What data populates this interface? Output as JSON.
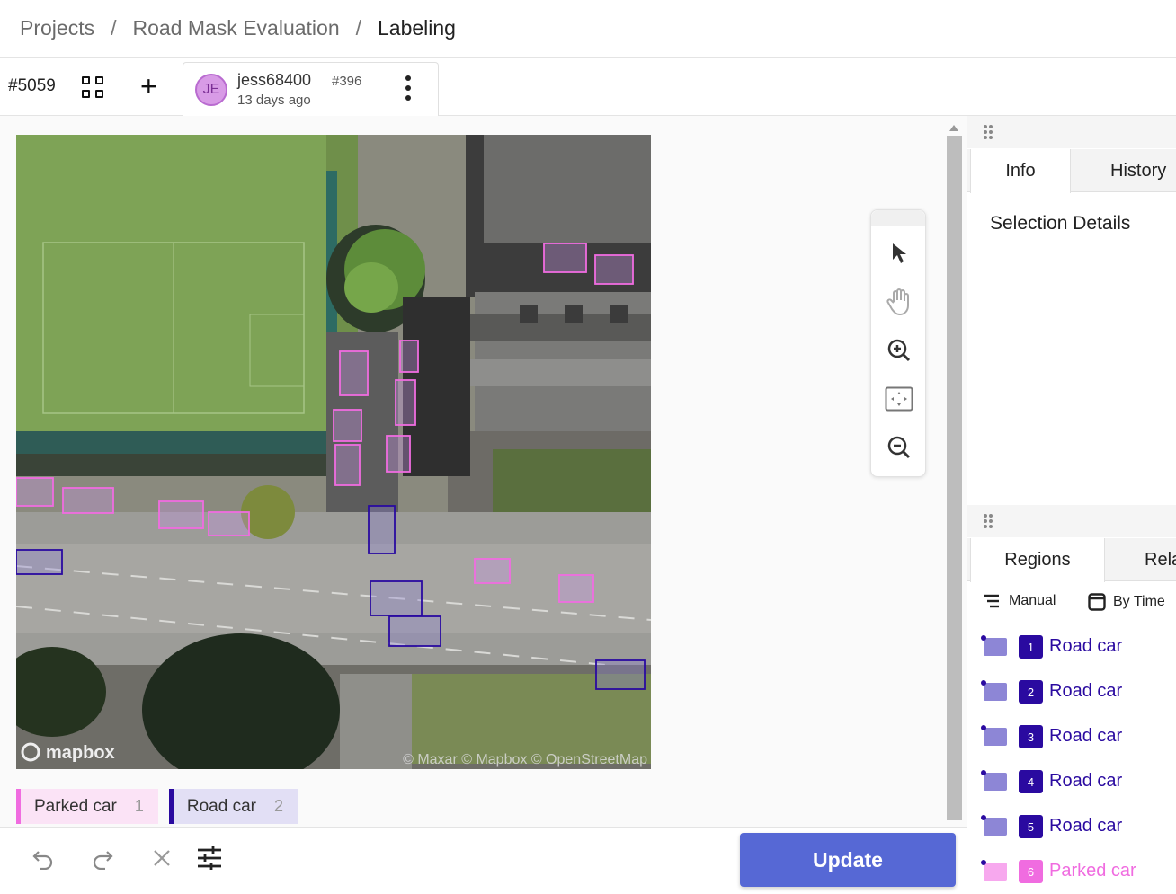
{
  "breadcrumb": {
    "items": [
      "Projects",
      "Road Mask Evaluation",
      "Labeling"
    ],
    "separator": "/"
  },
  "toolbar": {
    "task_id": "#5059",
    "grid_icon": "grid-icon",
    "add_icon": "plus-icon",
    "annotation": {
      "avatar_initials": "JE",
      "user": "jess68400",
      "annotation_id": "#396",
      "time": "13 days ago"
    }
  },
  "canvas": {
    "image_alt": "aerial satellite view of road with parked cars",
    "watermark_left": "mapbox",
    "watermark_right": "© Maxar © Mapbox © OpenStreetMap"
  },
  "tools": [
    "cursor-icon",
    "hand-icon",
    "zoom-in-icon",
    "fit-screen-icon",
    "zoom-out-icon"
  ],
  "labels": [
    {
      "name": "Parked car",
      "hotkey": "1",
      "color": "#f06ce0"
    },
    {
      "name": "Road car",
      "hotkey": "2",
      "color": "#2a0aa0"
    }
  ],
  "bottom": {
    "update_label": "Update",
    "icons": [
      "undo-icon",
      "redo-icon",
      "close-icon",
      "settings-sliders-icon"
    ]
  },
  "sidebar": {
    "top_tabs": [
      "Info",
      "History"
    ],
    "selection_details": "Selection Details",
    "bottom_tabs": [
      "Regions",
      "Rela"
    ],
    "sort": {
      "manual": "Manual",
      "by_time": "By Time"
    },
    "regions": [
      {
        "num": "1",
        "label": "Road car",
        "color": "#2a0aa0"
      },
      {
        "num": "2",
        "label": "Road car",
        "color": "#2a0aa0"
      },
      {
        "num": "3",
        "label": "Road car",
        "color": "#2a0aa0"
      },
      {
        "num": "4",
        "label": "Road car",
        "color": "#2a0aa0"
      },
      {
        "num": "5",
        "label": "Road car",
        "color": "#2a0aa0"
      },
      {
        "num": "6",
        "label": "Parked car",
        "color": "#f06ce0"
      }
    ]
  }
}
